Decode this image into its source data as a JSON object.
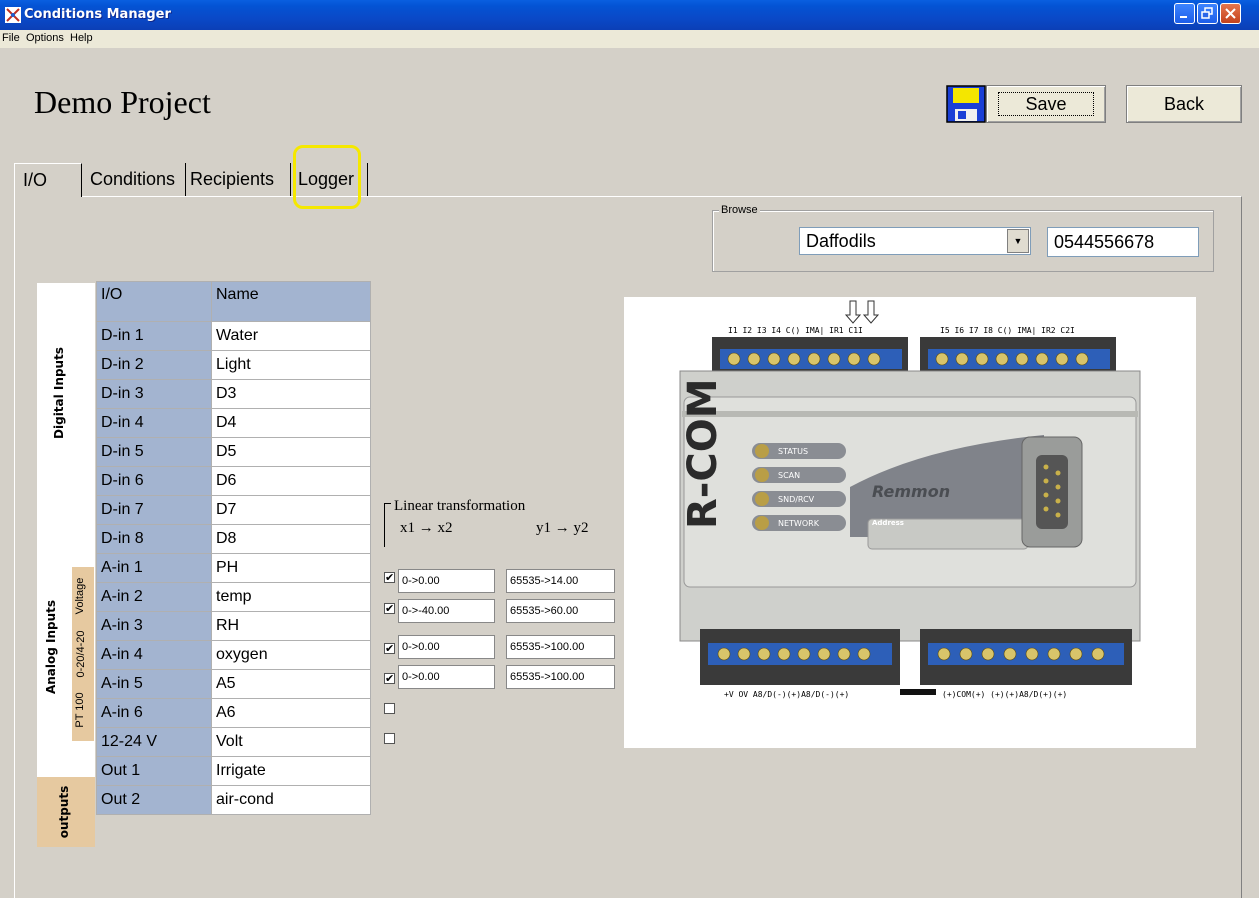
{
  "window": {
    "title": "Conditions Manager"
  },
  "menu": {
    "items": [
      "File",
      "Options",
      "Help"
    ]
  },
  "project": {
    "title": "Demo Project"
  },
  "toolbar": {
    "save_label": "Save",
    "back_label": "Back",
    "save_icon": "floppy-disk-icon"
  },
  "tabs": [
    "I/O",
    "Conditions",
    "Recipients",
    "Logger"
  ],
  "browse": {
    "label": "Browse",
    "selected": "Daffodils",
    "phone": "0544556678"
  },
  "sections": {
    "digital": "Digital Inputs",
    "analog": "Analog Inputs",
    "outputs": "outputs",
    "voltage": "Voltage",
    "current": "0-20/4-20",
    "pt100": "PT 100"
  },
  "table": {
    "headers": [
      "I/O",
      "Name"
    ],
    "rows": [
      [
        "D-in 1",
        "Water"
      ],
      [
        "D-in 2",
        "Light"
      ],
      [
        "D-in 3",
        "D3"
      ],
      [
        "D-in 4",
        "D4"
      ],
      [
        "D-in 5",
        "D5"
      ],
      [
        "D-in 6",
        "D6"
      ],
      [
        "D-in 7",
        "D7"
      ],
      [
        "D-in 8",
        "D8"
      ],
      [
        "A-in 1",
        "PH"
      ],
      [
        "A-in 2",
        "temp"
      ],
      [
        "A-in 3",
        "RH"
      ],
      [
        "A-in 4",
        "oxygen"
      ],
      [
        "A-in 5",
        "A5"
      ],
      [
        "A-in 6",
        "A6"
      ],
      [
        "12-24 V",
        "Volt"
      ],
      [
        "Out 1",
        "Irrigate"
      ],
      [
        "Out 2",
        "air-cond"
      ]
    ]
  },
  "transform": {
    "title": "Linear transformation",
    "x_header": "x1 → x2",
    "y_header": "y1 → y2",
    "rows": [
      {
        "checked": true,
        "x": "0->0.00",
        "y": "65535->14.00"
      },
      {
        "checked": true,
        "x": "0->-40.00",
        "y": "65535->60.00"
      },
      {
        "checked": true,
        "x": "0->0.00",
        "y": "65535->100.00"
      },
      {
        "checked": true,
        "x": "0->0.00",
        "y": "65535->100.00"
      },
      {
        "checked": false
      },
      {
        "checked": false
      }
    ]
  },
  "device": {
    "brand": "R-COM",
    "maker": "Remmon",
    "address_label": "Address",
    "leds": [
      "STATUS",
      "SCAN",
      "SND/RCV",
      "NETWORK"
    ],
    "top_left_terminals": "I1 I2 I3 I4 C() IMA| IR1 C1I",
    "top_right_terminals": "I5 I6 I7 I8 C() IMA| IR2 C2I",
    "bottom_left_terminals": "+V OV A8/D(-)(+)A8/D(-)(+)",
    "bottom_right_terminals": "(+)COM(+) (+)(+)A8/D(+)(+)"
  },
  "colors": {
    "header_blue": "#a3b4d0",
    "tan": "#e6c9a0",
    "highlight": "#f5e800"
  }
}
